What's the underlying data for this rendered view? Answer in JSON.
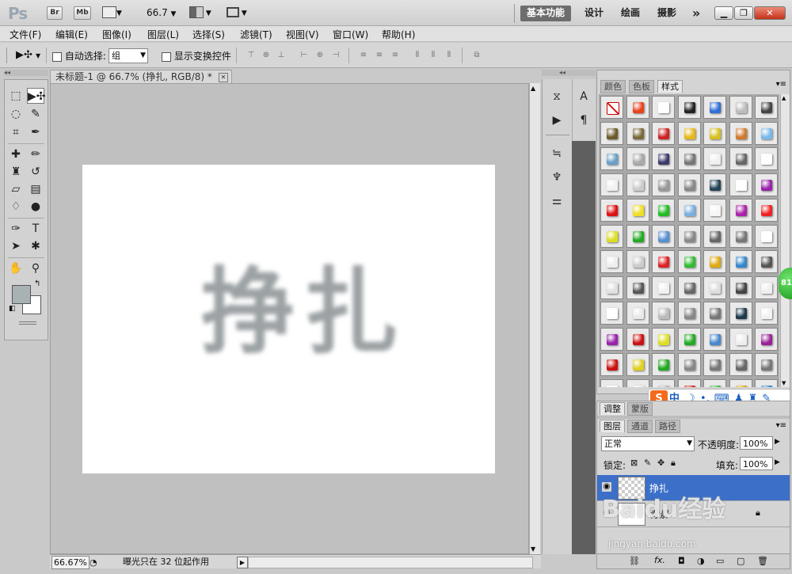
{
  "app": {
    "logo": "Ps",
    "bridge_label": "Br",
    "minibridge_label": "Mb",
    "zoom_value": "66.7",
    "workspaces": [
      "基本功能",
      "设计",
      "绘画",
      "摄影"
    ],
    "more_label": "»"
  },
  "menu": [
    "文件(F)",
    "编辑(E)",
    "图像(I)",
    "图层(L)",
    "选择(S)",
    "滤镜(T)",
    "视图(V)",
    "窗口(W)",
    "帮助(H)"
  ],
  "options": {
    "auto_select_label": "自动选择:",
    "auto_select_value": "组",
    "show_transform_label": "显示变换控件"
  },
  "document": {
    "tab_title": "未标题-1 @ 66.7% (挣扎, RGB/8) *",
    "canvas_text": "挣扎",
    "zoom_status": "66.67%",
    "status_text": "曝光只在 32 位起作用"
  },
  "panels": {
    "color_tab": "颜色",
    "swatches_tab": "色板",
    "styles_tab": "样式",
    "adjust_tab": "调整",
    "masks_tab": "蒙版",
    "layers_tab": "图层",
    "channels_tab": "通道",
    "paths_tab": "路径",
    "blend_mode": "正常",
    "opacity_label": "不透明度:",
    "opacity_value": "100%",
    "lock_label": "锁定:",
    "fill_label": "填充:",
    "fill_value": "100%"
  },
  "layers": [
    {
      "name": "挣扎",
      "selected": true
    },
    {
      "name": "背景",
      "selected": false
    }
  ],
  "sogou": {
    "label": "中"
  },
  "badge": {
    "value": "81"
  },
  "watermark": {
    "brand": "Baidu经验",
    "url": "jingyan.baidu.com"
  },
  "style_swatches": [
    "none",
    "#e8411c",
    "#ffffff",
    "#222222",
    "#2f6fd6",
    "#bdbdbd",
    "#444444",
    "#6b5a2a",
    "#7a6a3a",
    "#cc2222",
    "#e8b818",
    "#d6c020",
    "#d07a30",
    "#7ab8e8",
    "#6aa0c8",
    "#aaaaaa",
    "#3a3a6a",
    "#777777",
    "#eeeeee",
    "#666666",
    "#ffffff",
    "#f0f0f0",
    "#cccccc",
    "#999999",
    "#888888",
    "#234456",
    "#ffffff",
    "#9922aa",
    "#dd1111",
    "#eedd22",
    "#22bb22",
    "#7ab0e0",
    "#f5f5f5",
    "#aa22aa",
    "#ee2222",
    "#dddd22",
    "#22aa22",
    "#5590d0",
    "#888888",
    "#666666",
    "#777777",
    "#ffffff",
    "#eeeeee",
    "#cccccc",
    "#dd2222",
    "#33bb33",
    "#ddaa11",
    "#3388cc",
    "#555555",
    "#e0e0e0",
    "#555555",
    "#f0f0f0",
    "#666666",
    "#dddddd",
    "#444444",
    "#eeeeee",
    "#ffffff",
    "#e8e8e8",
    "#bbbbbb",
    "#888888",
    "#777777",
    "#1d3a4a",
    "#f2f2f2",
    "#9922aa",
    "#cc1111",
    "#dddd22",
    "#22aa22",
    "#4a88cc",
    "#eeeeee",
    "#992299",
    "#cc1111",
    "#e0d020",
    "#22aa22",
    "#888888",
    "#777777",
    "#666666",
    "#777777",
    "#ffffff",
    "#eeeeee",
    "#bbbbbb",
    "#dd2222",
    "#44bb44",
    "#ddaa11",
    "#3388cc"
  ]
}
